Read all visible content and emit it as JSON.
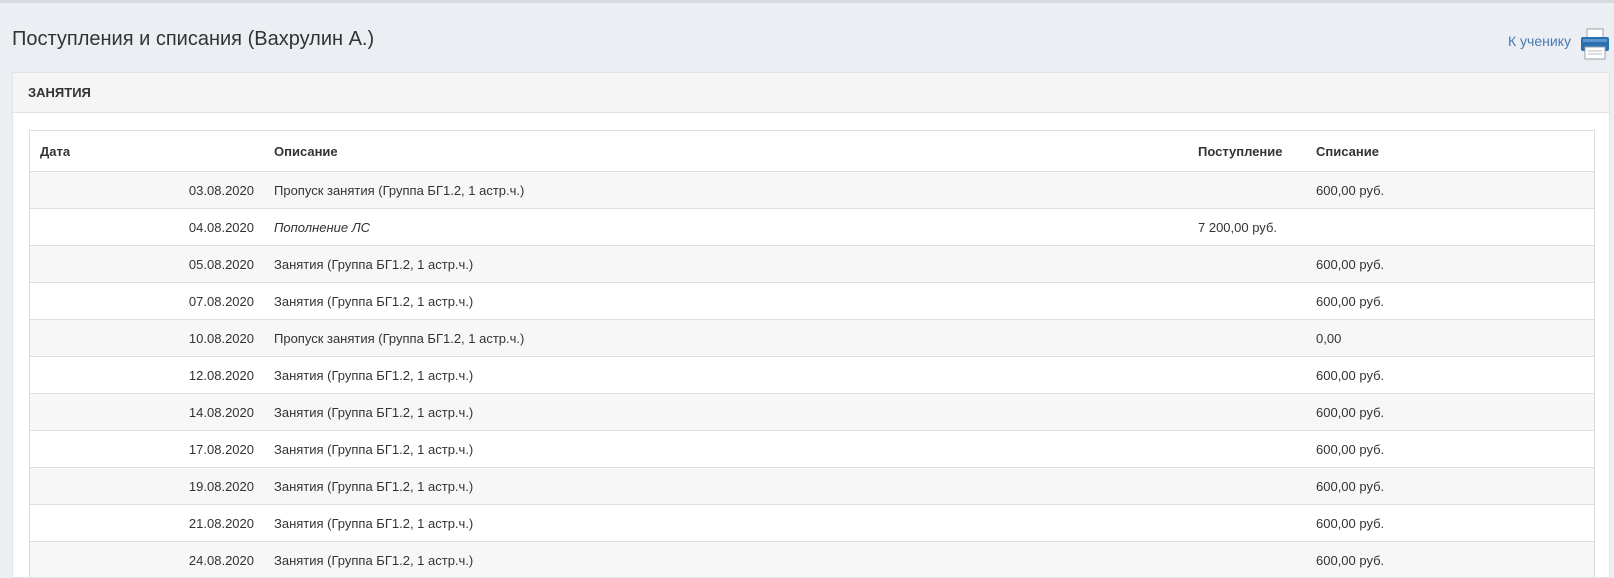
{
  "page": {
    "title": "Поступления и списания (Вахрулин А.)",
    "back_link": "К ученику",
    "print_icon": "printer-icon"
  },
  "panel": {
    "title": "ЗАНЯТИЯ"
  },
  "table": {
    "columns": [
      "Дата",
      "Описание",
      "Поступление",
      "Списание"
    ],
    "rows": [
      {
        "date": "03.08.2020",
        "desc": "Пропуск занятия (Группа БГ1.2, 1 астр.ч.)",
        "income": "",
        "charge": "600,00 руб.",
        "italic": false
      },
      {
        "date": "04.08.2020",
        "desc": "Пополнение ЛС",
        "income": "7 200,00 руб.",
        "charge": "",
        "italic": true
      },
      {
        "date": "05.08.2020",
        "desc": "Занятия (Группа БГ1.2, 1 астр.ч.)",
        "income": "",
        "charge": "600,00 руб.",
        "italic": false
      },
      {
        "date": "07.08.2020",
        "desc": "Занятия (Группа БГ1.2, 1 астр.ч.)",
        "income": "",
        "charge": "600,00 руб.",
        "italic": false
      },
      {
        "date": "10.08.2020",
        "desc": "Пропуск занятия (Группа БГ1.2, 1 астр.ч.)",
        "income": "",
        "charge": "0,00",
        "italic": false
      },
      {
        "date": "12.08.2020",
        "desc": "Занятия (Группа БГ1.2, 1 астр.ч.)",
        "income": "",
        "charge": "600,00 руб.",
        "italic": false
      },
      {
        "date": "14.08.2020",
        "desc": "Занятия (Группа БГ1.2, 1 астр.ч.)",
        "income": "",
        "charge": "600,00 руб.",
        "italic": false
      },
      {
        "date": "17.08.2020",
        "desc": "Занятия (Группа БГ1.2, 1 астр.ч.)",
        "income": "",
        "charge": "600,00 руб.",
        "italic": false
      },
      {
        "date": "19.08.2020",
        "desc": "Занятия (Группа БГ1.2, 1 астр.ч.)",
        "income": "",
        "charge": "600,00 руб.",
        "italic": false
      },
      {
        "date": "21.08.2020",
        "desc": "Занятия (Группа БГ1.2, 1 астр.ч.)",
        "income": "",
        "charge": "600,00 руб.",
        "italic": false
      },
      {
        "date": "24.08.2020",
        "desc": "Занятия (Группа БГ1.2, 1 астр.ч.)",
        "income": "",
        "charge": "600,00 руб.",
        "italic": false
      }
    ]
  },
  "colors": {
    "background": "#ebeef2",
    "link": "#4a78b0",
    "row_stripe": "#f7f7f7",
    "printer_blue": "#2a6fb0"
  }
}
